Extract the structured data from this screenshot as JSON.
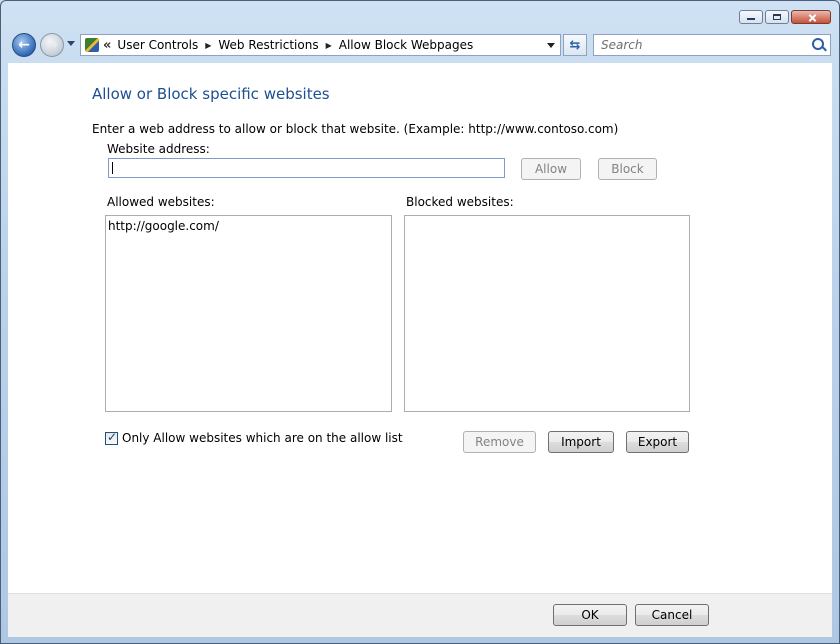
{
  "window": {
    "caption_buttons": [
      "minimize",
      "maximize",
      "close"
    ]
  },
  "nav": {
    "address": {
      "overflow": "«",
      "crumbs": [
        "User Controls",
        "Web Restrictions",
        "Allow Block Webpages"
      ]
    },
    "search": {
      "placeholder": "Search"
    }
  },
  "main": {
    "title": "Allow or Block specific websites",
    "instructions": "Enter a web address to allow or block that website.  (Example: http://www.contoso.com)",
    "address_label": "Website address:",
    "address_value": "",
    "allow_label": "Allow",
    "block_label": "Block",
    "allowed_label": "Allowed websites:",
    "blocked_label": "Blocked websites:",
    "allowed_items": [
      "http://google.com/"
    ],
    "blocked_items": [],
    "only_allow_label": "Only Allow websites which are on the allow list",
    "only_allow_checked": true,
    "remove_label": "Remove",
    "import_label": "Import",
    "export_label": "Export"
  },
  "footer": {
    "ok_label": "OK",
    "cancel_label": "Cancel"
  },
  "colors": {
    "title": "#1e4f91",
    "frame": "#bcd3ea"
  }
}
